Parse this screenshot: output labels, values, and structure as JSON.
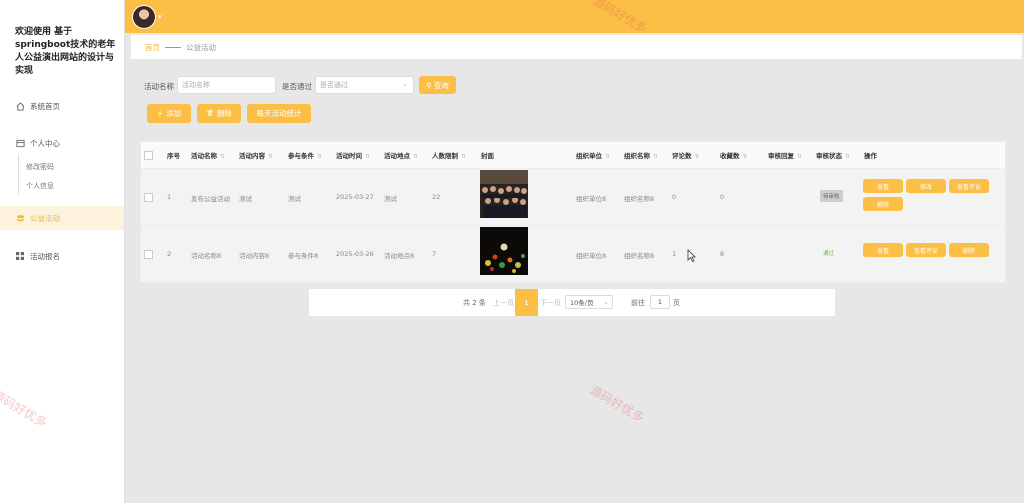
{
  "app": {
    "title": "欢迎使用 基于springboot技术的老年人公益演出网站的设计与实现"
  },
  "sidebar": {
    "home": "系统首页",
    "center": "个人中心",
    "sub_items": [
      "修改密码",
      "个人信息"
    ],
    "activity": "公益活动",
    "signup": "活动报名"
  },
  "breadcrumb": {
    "home": "首页",
    "current": "公益活动"
  },
  "search": {
    "name_label": "活动名称",
    "name_placeholder": "活动名称",
    "pass_label": "是否通过",
    "pass_placeholder": "是否通过",
    "query_button": "查询"
  },
  "toolbar": {
    "add": "添加",
    "delete": "删除",
    "stats": "每天活动统计"
  },
  "table": {
    "headers": [
      "序号",
      "活动名称",
      "活动内容",
      "参与条件",
      "活动时间",
      "活动地点",
      "人数限制",
      "封面",
      "组织单位",
      "组织名称",
      "评论数",
      "收藏数",
      "审核回复",
      "审核状态",
      "操作"
    ],
    "rows": [
      {
        "index": "1",
        "name": "发布公益活动",
        "content": "测试",
        "condition": "测试",
        "time": "2025-03-27",
        "place": "测试",
        "limit": "22",
        "unit": "组织单位8",
        "org": "组织名称8",
        "comments": "0",
        "favorites": "0",
        "reply": "",
        "status": "待审核",
        "actions": [
          "查看",
          "修改",
          "查看评论",
          "删除"
        ]
      },
      {
        "index": "2",
        "name": "活动名称8",
        "content": "活动内容8",
        "condition": "参与条件8",
        "time": "2025-03-26",
        "place": "活动地点8",
        "limit": "7",
        "unit": "组织单位8",
        "org": "组织名称8",
        "comments": "1",
        "favorites": "8",
        "reply": "",
        "status": "通过",
        "actions": [
          "查看",
          "查看评论",
          "删除"
        ]
      }
    ]
  },
  "pagination": {
    "total": "共 2 条",
    "prev": "上一页",
    "current": "1",
    "next": "下一页",
    "size": "10条/页",
    "goto": "前往",
    "goto_value": "1",
    "page_unit": "页"
  },
  "watermark": "源码好优多",
  "colors": {
    "accent": "#fbbf45",
    "pass": "#67c23a"
  }
}
